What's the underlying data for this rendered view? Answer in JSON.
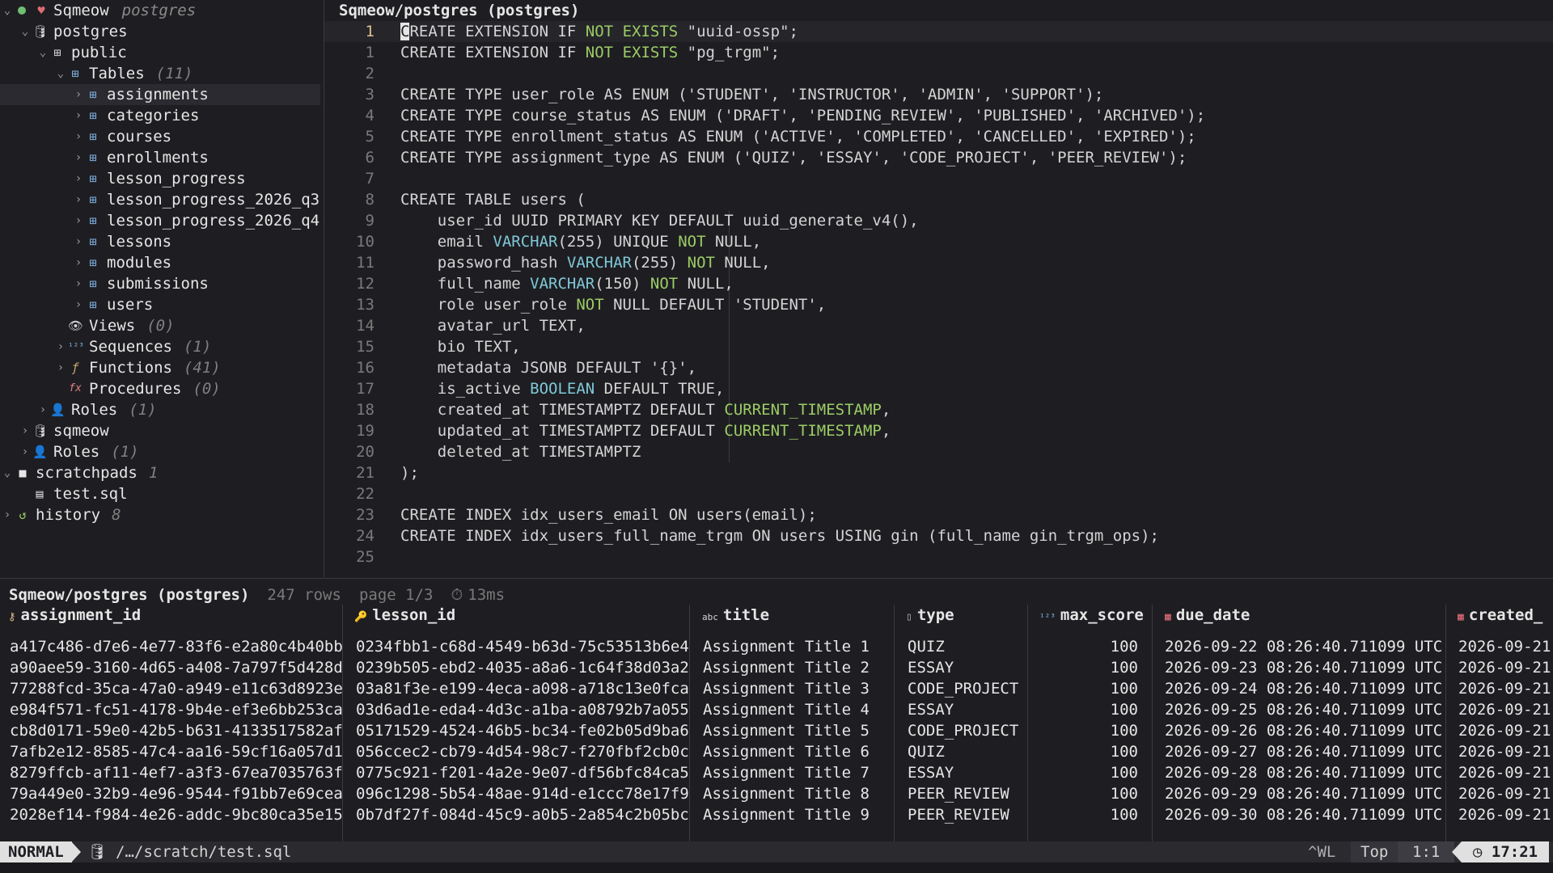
{
  "sidebar": {
    "connection": {
      "label": "Sqmeow",
      "subtitle": "postgres"
    },
    "database": {
      "label": "postgres"
    },
    "schema": {
      "label": "public"
    },
    "tables": {
      "label": "Tables",
      "count": "(11)"
    },
    "table_items": [
      "assignments",
      "categories",
      "courses",
      "enrollments",
      "lesson_progress",
      "lesson_progress_2026_q3",
      "lesson_progress_2026_q4",
      "lessons",
      "modules",
      "submissions",
      "users"
    ],
    "views": {
      "label": "Views",
      "count": "(0)"
    },
    "sequences": {
      "label": "Sequences",
      "count": "(1)"
    },
    "functions": {
      "label": "Functions",
      "count": "(41)"
    },
    "procedures": {
      "label": "Procedures",
      "count": "(0)"
    },
    "schema_roles": {
      "label": "Roles",
      "count": "(1)"
    },
    "db_sqmeow": {
      "label": "sqmeow"
    },
    "roles": {
      "label": "Roles",
      "count": "(1)"
    },
    "scratchpads": {
      "label": "scratchpads",
      "count": "1"
    },
    "scratch_file": {
      "label": "test.sql"
    },
    "history": {
      "label": "history",
      "count": "8"
    }
  },
  "editor": {
    "title": "Sqmeow/postgres (postgres)",
    "line_numbers": [
      "1",
      "1",
      "2",
      "3",
      "4",
      "5",
      "6",
      "7",
      "8",
      "9",
      "10",
      "11",
      "12",
      "13",
      "14",
      "15",
      "16",
      "17",
      "18",
      "19",
      "20",
      "21",
      "22",
      "23",
      "24",
      "25"
    ]
  },
  "results": {
    "title": "Sqmeow/postgres (postgres)",
    "rows": "247 rows",
    "page": "page 1/3",
    "time": "13ms",
    "columns": [
      "assignment_id",
      "lesson_id",
      "title",
      "type",
      "max_score",
      "due_date",
      "created_"
    ],
    "data": [
      [
        "a417c486-d7e6-4e77-83f6-e2a80c4b40bb",
        "0234fbb1-c68d-4549-b63d-75c53513b6e4",
        "Assignment Title 1",
        "QUIZ",
        "100",
        "2026-09-22 08:26:40.711099 UTC",
        "2026-09-21"
      ],
      [
        "a90aee59-3160-4d65-a408-7a797f5d428d",
        "0239b505-ebd2-4035-a8a6-1c64f38d03a2",
        "Assignment Title 2",
        "ESSAY",
        "100",
        "2026-09-23 08:26:40.711099 UTC",
        "2026-09-21"
      ],
      [
        "77288fcd-35ca-47a0-a949-e11c63d8923e",
        "03a81f3e-e199-4eca-a098-a718c13e0fca",
        "Assignment Title 3",
        "CODE_PROJECT",
        "100",
        "2026-09-24 08:26:40.711099 UTC",
        "2026-09-21"
      ],
      [
        "e984f571-fc51-4178-9b4e-ef3e6bb253ca",
        "03d6ad1e-eda4-4d3c-a1ba-a08792b7a055",
        "Assignment Title 4",
        "ESSAY",
        "100",
        "2026-09-25 08:26:40.711099 UTC",
        "2026-09-21"
      ],
      [
        "cb8d0171-59e0-42b5-b631-4133517582af",
        "05171529-4524-46b5-bc34-fe02b05d9ba6",
        "Assignment Title 5",
        "CODE_PROJECT",
        "100",
        "2026-09-26 08:26:40.711099 UTC",
        "2026-09-21"
      ],
      [
        "7afb2e12-8585-47c4-aa16-59cf16a057d1",
        "056ccec2-cb79-4d54-98c7-f270fbf2cb0c",
        "Assignment Title 6",
        "QUIZ",
        "100",
        "2026-09-27 08:26:40.711099 UTC",
        "2026-09-21"
      ],
      [
        "8279ffcb-af11-4ef7-a3f3-67ea7035763f",
        "0775c921-f201-4a2e-9e07-df56bfc84ca5",
        "Assignment Title 7",
        "ESSAY",
        "100",
        "2026-09-28 08:26:40.711099 UTC",
        "2026-09-21"
      ],
      [
        "79a449e0-32b9-4e96-9544-f91bb7e69cea",
        "096c1298-5b54-48ae-914d-e1ccc78e17f9",
        "Assignment Title 8",
        "PEER_REVIEW",
        "100",
        "2026-09-29 08:26:40.711099 UTC",
        "2026-09-21"
      ],
      [
        "2028ef14-f984-4e26-addc-9bc80ca35e15",
        "0b7df27f-084d-45c9-a0b5-2a854c2b05bc",
        "Assignment Title 9",
        "PEER_REVIEW",
        "100",
        "2026-09-30 08:26:40.711099 UTC",
        "2026-09-21"
      ]
    ]
  },
  "statusbar": {
    "mode": "NORMAL",
    "filepath": "/…/scratch/test.sql",
    "keys": "^WL",
    "scroll": "Top",
    "position": "1:1",
    "clock": "17:21"
  }
}
